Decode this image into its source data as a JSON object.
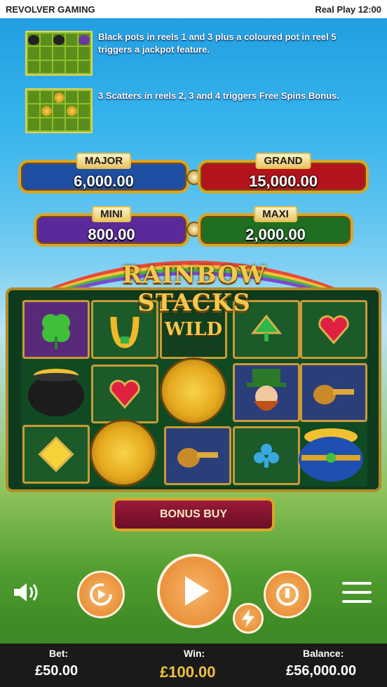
{
  "status_bar": {
    "left": "REVOLVER GAMING",
    "right": "Real Play  12:00"
  },
  "rules": [
    {
      "text_line1": "Black pots in reels 1 and 3 plus a coloured pot in reel 5",
      "text_line2": "triggers a jackpot feature."
    },
    {
      "text_line1": "3 Scatters in reels 2, 3 and 4 triggers Free Spins Bonus.",
      "text_line2": ""
    }
  ],
  "jackpots": {
    "major": {
      "label": "MAJOR",
      "value": "6,000.00",
      "color": "#1f4fa3"
    },
    "grand": {
      "label": "GRAND",
      "value": "15,000.00",
      "color": "#b3141c"
    },
    "mini": {
      "label": "MINI",
      "value": "800.00",
      "color": "#5b2a9a"
    },
    "maxi": {
      "label": "MAXI",
      "value": "2,000.00",
      "color": "#1f6e22"
    }
  },
  "logo": "RAINBOW STACKS",
  "reels": {
    "wild_label": "WILD",
    "symbols": [
      "clover",
      "horseshoe",
      "wild",
      "spade-gem",
      "heart-gem",
      "black-pot",
      "heart-gem",
      "celtic-coin",
      "leprechaun",
      "pipe",
      "yellow-diamond",
      "celtic-coin",
      "pipe",
      "club-gem",
      "blue-pot"
    ]
  },
  "bonus_buy": {
    "label": "BONUS BUY"
  },
  "controls": {
    "sound_icon": "speaker-icon",
    "autoplay_icon": "autoplay-icon",
    "spin_icon": "play-icon",
    "turbo_icon": "lightning-icon",
    "bet_icon": "coin-stack-icon",
    "menu_icon": "hamburger-icon"
  },
  "footer": {
    "bet_label": "Bet:",
    "bet_value": "£50.00",
    "win_label": "Win:",
    "win_value": "£100.00",
    "balance_label": "Balance:",
    "balance_value": "£56,000.00"
  }
}
